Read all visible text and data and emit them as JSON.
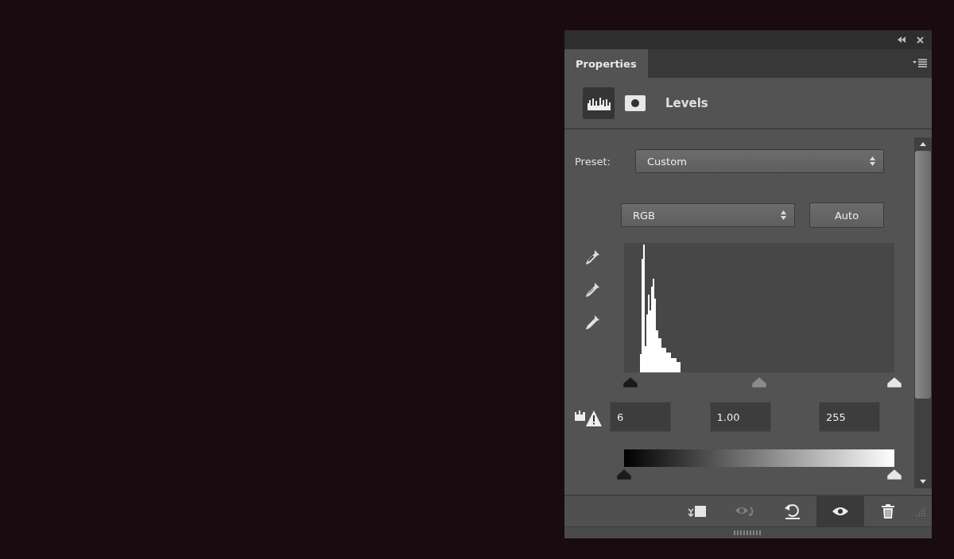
{
  "panel": {
    "tabs": [
      {
        "label": "Properties",
        "selected": true
      }
    ],
    "header": {
      "modes": [
        {
          "kind": "adjustment",
          "selected": true
        },
        {
          "kind": "mask",
          "selected": false
        }
      ],
      "title": "Levels"
    },
    "preset": {
      "label": "Preset:",
      "value": "Custom"
    },
    "channel": {
      "value": "RGB"
    },
    "auto_button": "Auto",
    "eyedroppers": [
      {
        "kind": "black"
      },
      {
        "kind": "gray"
      },
      {
        "kind": "white"
      }
    ],
    "input_thumbs": [
      {
        "kind": "shadow",
        "level": 0.024
      },
      {
        "kind": "midtone",
        "level": 0.5
      },
      {
        "kind": "highlight",
        "level": 1
      }
    ],
    "input_fields": [
      "6",
      "1.00",
      "255"
    ],
    "output_thumbs": [
      {
        "kind": "shadow",
        "level": 0
      },
      {
        "kind": "highlight",
        "level": 1
      }
    ],
    "footer_buttons": [
      {
        "kind": "clip",
        "on": false,
        "disabled": false
      },
      {
        "kind": "previous",
        "on": false,
        "disabled": true
      },
      {
        "kind": "reset",
        "on": false,
        "disabled": false
      },
      {
        "kind": "visibility",
        "on": true,
        "disabled": false
      },
      {
        "kind": "delete",
        "on": false,
        "disabled": false
      }
    ]
  }
}
